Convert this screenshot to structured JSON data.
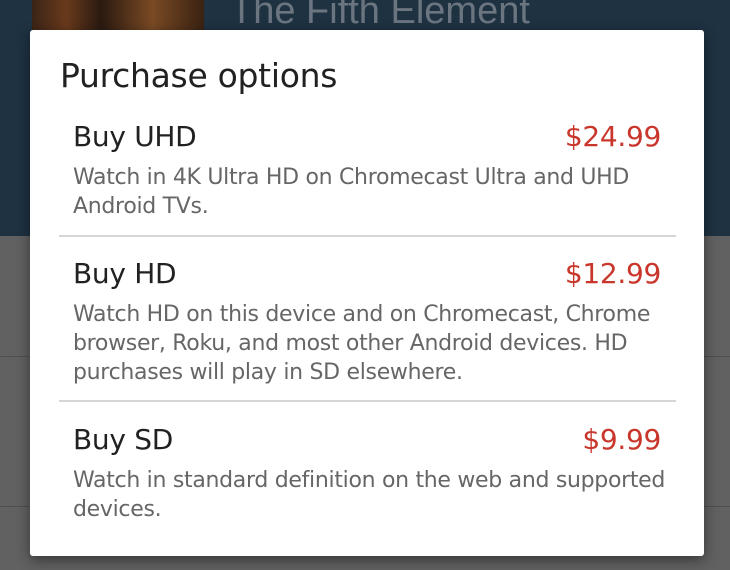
{
  "background": {
    "movie_title": "The Fifth Element"
  },
  "dialog": {
    "title": "Purchase options",
    "options": [
      {
        "name": "Buy UHD",
        "price": "$24.99",
        "description": "Watch in 4K Ultra HD on Chromecast Ultra and UHD Android TVs."
      },
      {
        "name": "Buy HD",
        "price": "$12.99",
        "description": "Watch HD on this device and on Chromecast, Chrome browser, Roku, and most other Android devices. HD purchases will play in SD elsewhere."
      },
      {
        "name": "Buy SD",
        "price": "$9.99",
        "description": "Watch in standard definition on the web and supported devices."
      }
    ]
  },
  "colors": {
    "price": "#c9362b",
    "header_background": "#1e3242",
    "scrim": "#616161"
  }
}
